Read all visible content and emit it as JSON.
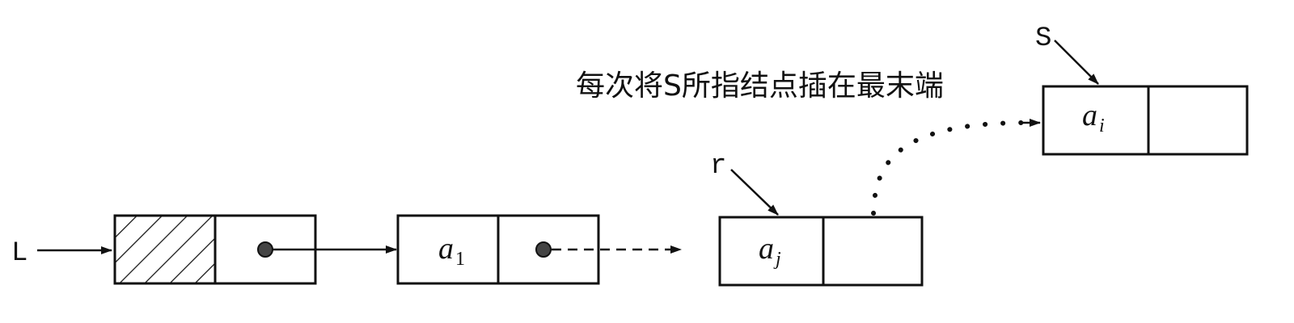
{
  "labels": {
    "head_pointer": "L",
    "tail_pointer": "r",
    "new_pointer": "S",
    "caption": "每次将S所指结点插在最末端"
  },
  "nodes": {
    "head": {
      "data": ""
    },
    "first": {
      "data": "a",
      "subscript": "1"
    },
    "last": {
      "data": "a",
      "subscript": "j"
    },
    "new": {
      "data": "a",
      "subscript": "i"
    }
  },
  "colors": {
    "line": "#111111",
    "pointer_dot": "#444444"
  }
}
